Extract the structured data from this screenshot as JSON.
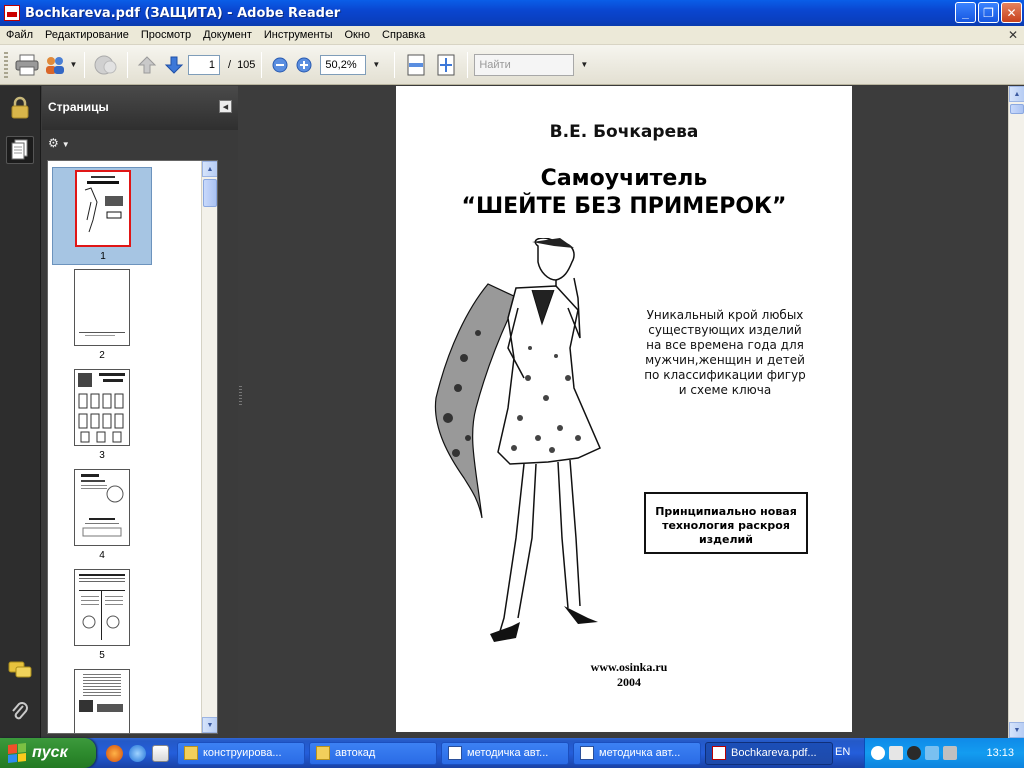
{
  "window": {
    "title": "Bochkareva.pdf (ЗАЩИТА) - Adobe Reader",
    "minimize_label": "_",
    "maximize_label": "❐",
    "close_label": "✕"
  },
  "menu": {
    "items": [
      "Файл",
      "Редактирование",
      "Просмотр",
      "Документ",
      "Инструменты",
      "Окно",
      "Справка"
    ],
    "close_doc": "✕"
  },
  "toolbar": {
    "current_page": "1",
    "page_separator": "/",
    "total_pages": "105",
    "zoom_value": "50,2%",
    "find_placeholder": "Найти"
  },
  "panel": {
    "title": "Страницы",
    "thumbnails": [
      {
        "num": "1",
        "selected": true
      },
      {
        "num": "2",
        "selected": false
      },
      {
        "num": "3",
        "selected": false
      },
      {
        "num": "4",
        "selected": false
      },
      {
        "num": "5",
        "selected": false
      },
      {
        "num": "",
        "selected": false
      }
    ]
  },
  "document": {
    "author": "В.Е. Бочкарева",
    "title_line1": "Самоучитель",
    "title_line2": "“ШЕЙТЕ БЕЗ ПРИМЕРОК”",
    "description": "Уникальный крой любых существующих изделий на все времена года для мужчин,женщин и детей по классификации фигур и схеме ключа",
    "boxed_text": "Принципиально новая технология раскроя изделий",
    "url": "www.osinka.ru",
    "year": "2004"
  },
  "taskbar": {
    "start_label": "пуск",
    "tasks": [
      {
        "label": "конструирова..."
      },
      {
        "label": "автокад"
      },
      {
        "label": "методичка авт..."
      },
      {
        "label": "методичка авт..."
      },
      {
        "label": "Bochkareva.pdf..."
      }
    ],
    "lang": "EN",
    "clock": "13:13"
  },
  "colors": {
    "titlebar": "#0a46d0",
    "panel_bg": "#3b3b3b",
    "selection": "#a6c5e3",
    "taskbar": "#245edb"
  }
}
